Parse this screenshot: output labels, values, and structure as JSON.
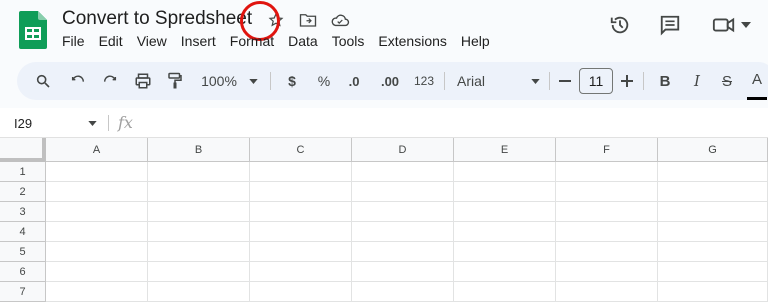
{
  "document": {
    "title": "Convert to Spredsheet"
  },
  "menu": [
    "File",
    "Edit",
    "View",
    "Insert",
    "Format",
    "Data",
    "Tools",
    "Extensions",
    "Help"
  ],
  "toolbar": {
    "zoom": "100%",
    "currency": "$",
    "percent": "%",
    "decrease_decimal": ".0",
    "increase_decimal": ".00",
    "number_format": "123",
    "font": "Arial",
    "font_size": "11",
    "bold": "B",
    "italic": "I",
    "strike": "S",
    "text_color": "A"
  },
  "formula_bar": {
    "cell_ref": "I29",
    "fx": "fx"
  },
  "grid": {
    "columns": [
      "A",
      "B",
      "C",
      "D",
      "E",
      "F",
      "G"
    ],
    "rows": [
      "1",
      "2",
      "3",
      "4",
      "5",
      "6",
      "7"
    ]
  },
  "colors": {
    "accent_red": "#e0140f",
    "sheets_green": "#0f9d58",
    "toolbar_bg": "#edf2fa"
  }
}
